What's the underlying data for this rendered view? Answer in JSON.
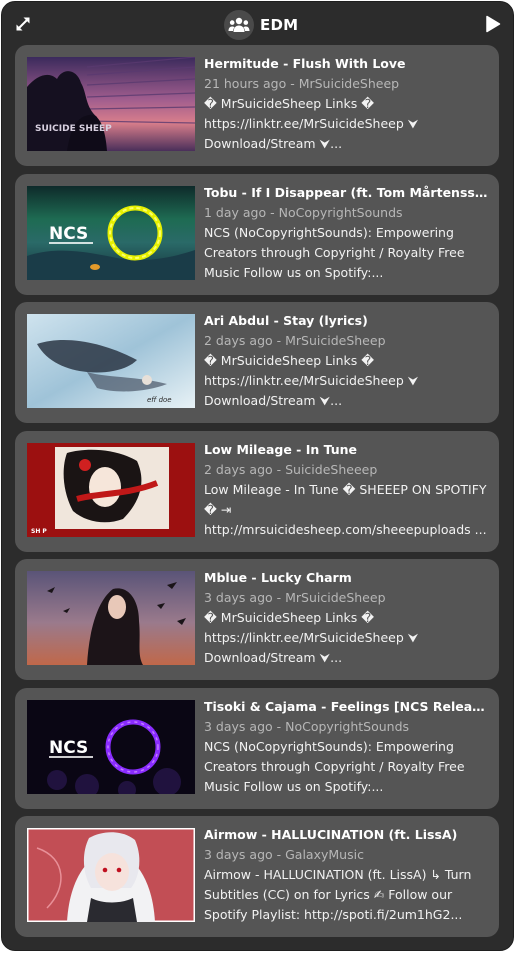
{
  "header": {
    "title": "EDM",
    "expand_icon": "expand-arrows-icon",
    "group_icon": "people-group-icon",
    "play_icon": "play-icon"
  },
  "colors": {
    "widget_bg": "#2c2c2c",
    "card_bg": "#555555",
    "meta_text": "#b7b7b7"
  },
  "videos": [
    {
      "title": "Hermitude - Flush With Love",
      "meta": "21 hours ago - MrSuicideSheep",
      "description": "� MrSuicideSheep Links � https://linktr.ee/MrSuicideSheep ⮟ Download/Stream ⮟...",
      "thumb_overlay": "SUICIDE SHEEP"
    },
    {
      "title": "Tobu - If I Disappear (ft. Tom Mårtensson) [NCS Release]",
      "meta": "1 day ago - NoCopyrightSounds",
      "description": "NCS (NoCopyrightSounds): Empowering Creators through Copyright / Royalty Free Music Follow us on Spotify:...",
      "thumb_overlay": "NCS"
    },
    {
      "title": "Ari Abdul - Stay (lyrics)",
      "meta": "2 days ago - MrSuicideSheep",
      "description": "� MrSuicideSheep Links � https://linktr.ee/MrSuicideSheep ⮟ Download/Stream ⮟...",
      "thumb_overlay": "eff doe"
    },
    {
      "title": "Low Mileage - In Tune",
      "meta": "2 days ago - SuicideSheeep",
      "description": "Low Mileage - In Tune � SHEEEP ON SPOTIFY � ⇥ http://mrsuicidesheep.com/sheeepuploads ...",
      "thumb_overlay": "SH   P"
    },
    {
      "title": "Mblue - Lucky Charm",
      "meta": "3 days ago - MrSuicideSheep",
      "description": "� MrSuicideSheep Links � https://linktr.ee/MrSuicideSheep ⮟ Download/Stream ⮟...",
      "thumb_overlay": ""
    },
    {
      "title": "Tisoki & Cajama - Feelings [NCS Release]",
      "meta": "3 days ago - NoCopyrightSounds",
      "description": "NCS (NoCopyrightSounds): Empowering Creators through Copyright / Royalty Free Music Follow us on Spotify:...",
      "thumb_overlay": "NCS"
    },
    {
      "title": "Airmow - HALLUCINATION (ft. LissA)",
      "meta": "3 days ago - GalaxyMusic",
      "description": "Airmow - HALLUCINATION (ft. LissA) ↳ Turn Subtitles (CC) on for Lyrics ✍ Follow our Spotify Playlist: http://spoti.fi/2um1hG2...",
      "thumb_overlay": ""
    }
  ]
}
